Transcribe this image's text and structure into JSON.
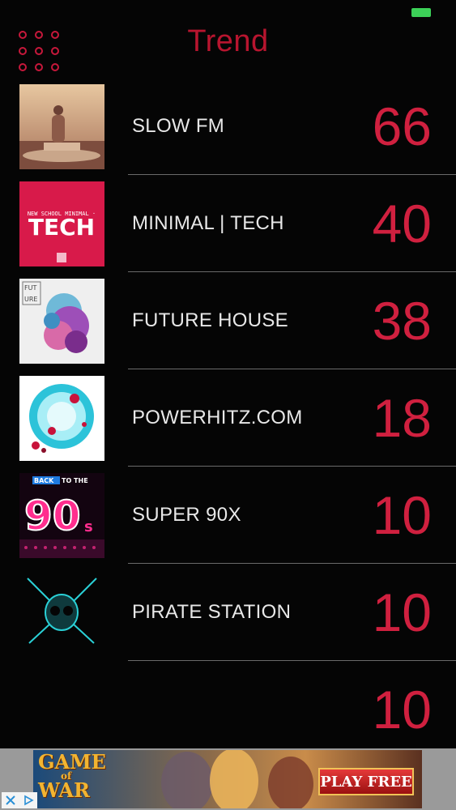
{
  "header": {
    "title": "Trend",
    "menu_icon": "grid-dots-icon"
  },
  "stations": [
    {
      "name": "SLOW FM",
      "count": "66"
    },
    {
      "name": "MINIMAL | TECH",
      "count": "40",
      "art_line1": "NEW SCHOOL MINIMAL ·",
      "art_line2": "TECH"
    },
    {
      "name": "FUTURE HOUSE",
      "count": "38",
      "art_line1": "FUT",
      "art_line2": "URE"
    },
    {
      "name": "POWERHITZ.COM",
      "count": "18"
    },
    {
      "name": "SUPER 90X",
      "count": "10",
      "art_line1": "BACK",
      "art_line2": "TO THE",
      "art_line3": "90",
      "art_line4": "s"
    },
    {
      "name": "PIRATE STATION",
      "count": "10"
    },
    {
      "name": "",
      "count": "10"
    }
  ],
  "ad": {
    "game_line1": "GAME",
    "game_line2": "of",
    "game_line3": "WAR",
    "play_label": "PLAY FREE"
  },
  "colors": {
    "accent": "#d0203f",
    "background": "#050505",
    "divider": "#6a6a6a"
  }
}
